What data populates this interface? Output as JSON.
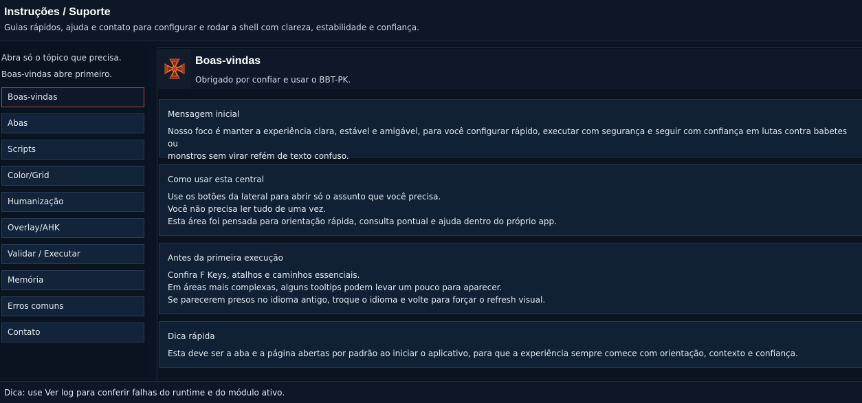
{
  "header": {
    "title": "Instruções / Suporte",
    "subtitle": "Guias rápidos, ajuda e contato para configurar e rodar a shell com clareza, estabilidade e confiança."
  },
  "sidebar": {
    "hint1": "Abra só o tópico que precisa.",
    "hint2": "Boas-vindas abre primeiro.",
    "items": [
      {
        "label": "Boas-vindas",
        "active": true
      },
      {
        "label": "Abas"
      },
      {
        "label": "Scripts"
      },
      {
        "label": "Color/Grid"
      },
      {
        "label": "Humanização"
      },
      {
        "label": "Overlay/AHK"
      },
      {
        "label": "Validar / Executar"
      },
      {
        "label": "Memória"
      },
      {
        "label": "Erros comuns"
      },
      {
        "label": "Contato"
      }
    ]
  },
  "welcome": {
    "title": "Boas-vindas",
    "subtitle": "Obrigado por confiar e usar o BBT-PK.",
    "logo_icon": "iron-cross-icon"
  },
  "cards": [
    {
      "title": "Mensagem inicial",
      "lines": [
        "Nosso foco é manter a experiência clara, estável e amigável, para você configurar rápido, executar com segurança e seguir com confiança em lutas contra babetes ou",
        "monstros sem virar refém de texto confuso."
      ]
    },
    {
      "title": "Como usar esta central",
      "lines": [
        "Use os botões da lateral para abrir só o assunto que você precisa.",
        "Você não precisa ler tudo de uma vez.",
        "Esta área foi pensada para orientação rápida, consulta pontual e ajuda dentro do próprio app."
      ]
    },
    {
      "title": "Antes da primeira execução",
      "lines": [
        "Confira F Keys, atalhos e caminhos essenciais.",
        "Em áreas mais complexas, alguns tooltips podem levar um pouco para aparecer.",
        "Se parecerem presos no idioma antigo, troque o idioma e volte para forçar o refresh visual."
      ]
    },
    {
      "title": "Dica rápida",
      "lines": [
        "Esta deve ser a aba e a página abertas por padrão ao iniciar o aplicativo, para que a experiência sempre comece com orientação, contexto e confiança."
      ]
    }
  ],
  "footer": {
    "tip": "Dica: use Ver log para conferir falhas do runtime e do módulo ativo."
  },
  "colors": {
    "background": "#0b1422",
    "card": "#122036",
    "button": "#13233a",
    "active_border": "#b8413e",
    "text": "#e2e8ef"
  }
}
